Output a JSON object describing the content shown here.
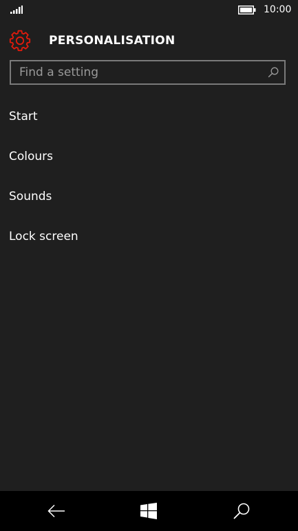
{
  "status_bar": {
    "time": "10:00",
    "signal_icon": "signal-bars-icon",
    "battery_icon": "battery-icon"
  },
  "header": {
    "icon": "gear-icon",
    "title": "PERSONALISATION"
  },
  "search": {
    "placeholder": "Find a setting",
    "value": "",
    "icon": "search-icon"
  },
  "settings": {
    "items": [
      {
        "label": "Start"
      },
      {
        "label": "Colours"
      },
      {
        "label": "Sounds"
      },
      {
        "label": "Lock screen"
      }
    ]
  },
  "nav_bar": {
    "back_icon": "back-arrow-icon",
    "home_icon": "windows-icon",
    "search_icon": "search-icon"
  },
  "colors": {
    "accent": "#e31b0c",
    "background": "#1f1f1f",
    "nav_background": "#000000",
    "text": "#ffffff",
    "placeholder": "#9a9a9a",
    "border": "#7a7a7a"
  }
}
